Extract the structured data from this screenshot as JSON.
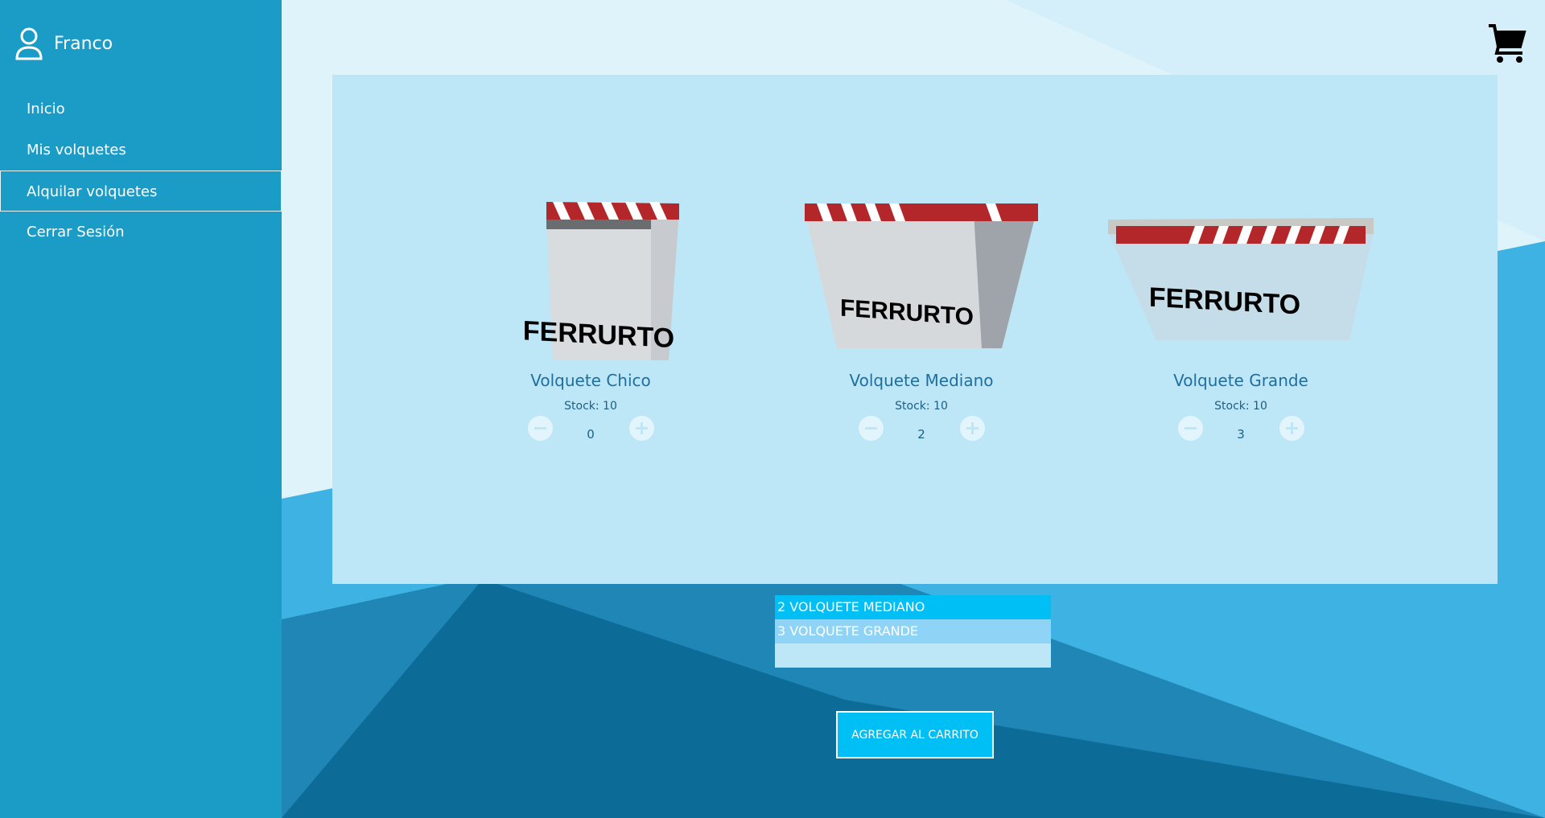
{
  "user": {
    "name": "Franco",
    "icon": "user-icon"
  },
  "nav": {
    "items": [
      {
        "label": "Inicio"
      },
      {
        "label": "Mis volquetes"
      },
      {
        "label": "Alquilar volquetes"
      },
      {
        "label": "Cerrar Sesión"
      }
    ],
    "active": "Alquilar volquetes"
  },
  "cart": {
    "icon": "cart-icon"
  },
  "products": [
    {
      "name": "Volquete Chico",
      "stock": "Stock: 10",
      "quantity": "0",
      "brand": "FERRURTO"
    },
    {
      "name": "Volquete Mediano",
      "stock": "Stock: 10",
      "quantity": "2",
      "brand": "FERRURTO"
    },
    {
      "name": "Volquete Grande",
      "stock": "Stock: 10",
      "quantity": "3",
      "brand": "FERRURTO"
    }
  ],
  "selection_list": {
    "items": [
      "2 VOLQUETE MEDIANO",
      "3 VOLQUETE GRANDE",
      ""
    ]
  },
  "add_button": {
    "label": "AGREGAR AL CARRITO"
  },
  "colors": {
    "sidebar": "#1b9cc6",
    "accent": "#00bff5",
    "panel": "#bde7f7",
    "text": "#1e6fa0"
  }
}
